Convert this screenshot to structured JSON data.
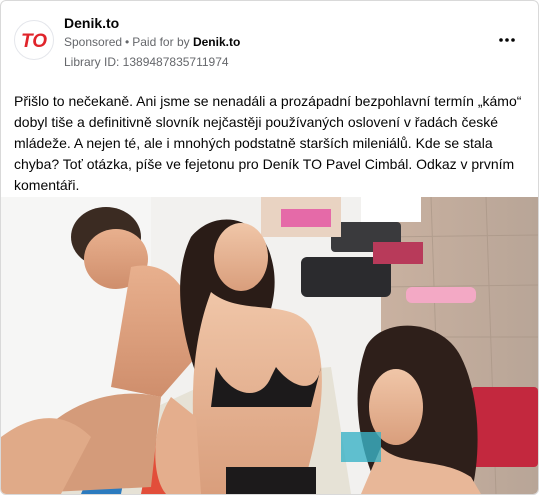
{
  "advertiser": {
    "name": "Denik.to",
    "logo_text": "TO",
    "logo_color": "#e0242b"
  },
  "ad_meta": {
    "sponsored_label": "Sponsored",
    "separator": "•",
    "paid_for_label": "Paid for by",
    "paid_for_page": "Denik.to",
    "library_id": "Library ID: 1389487835711974"
  },
  "menu": {
    "icon": "more-horizontal-icon"
  },
  "post": {
    "text": "Přišlo to nečekaně. Ani jsme se nenadáli a prozápadní bezpohlavní termín „kámo“ dobyl tiše a definitivně slovník nejčastěji používaných oslovení v řadách české mládeže. A nejen té, ale i mnohých podstatně starších mileniálů. Kde se stala chyba? Toť otázka, píše ve fejetonu pro Deník TO Pavel Cimbál. Odkaz v prvním komentáři."
  },
  "image": {
    "subject": "young people sunbathing by a pool"
  }
}
